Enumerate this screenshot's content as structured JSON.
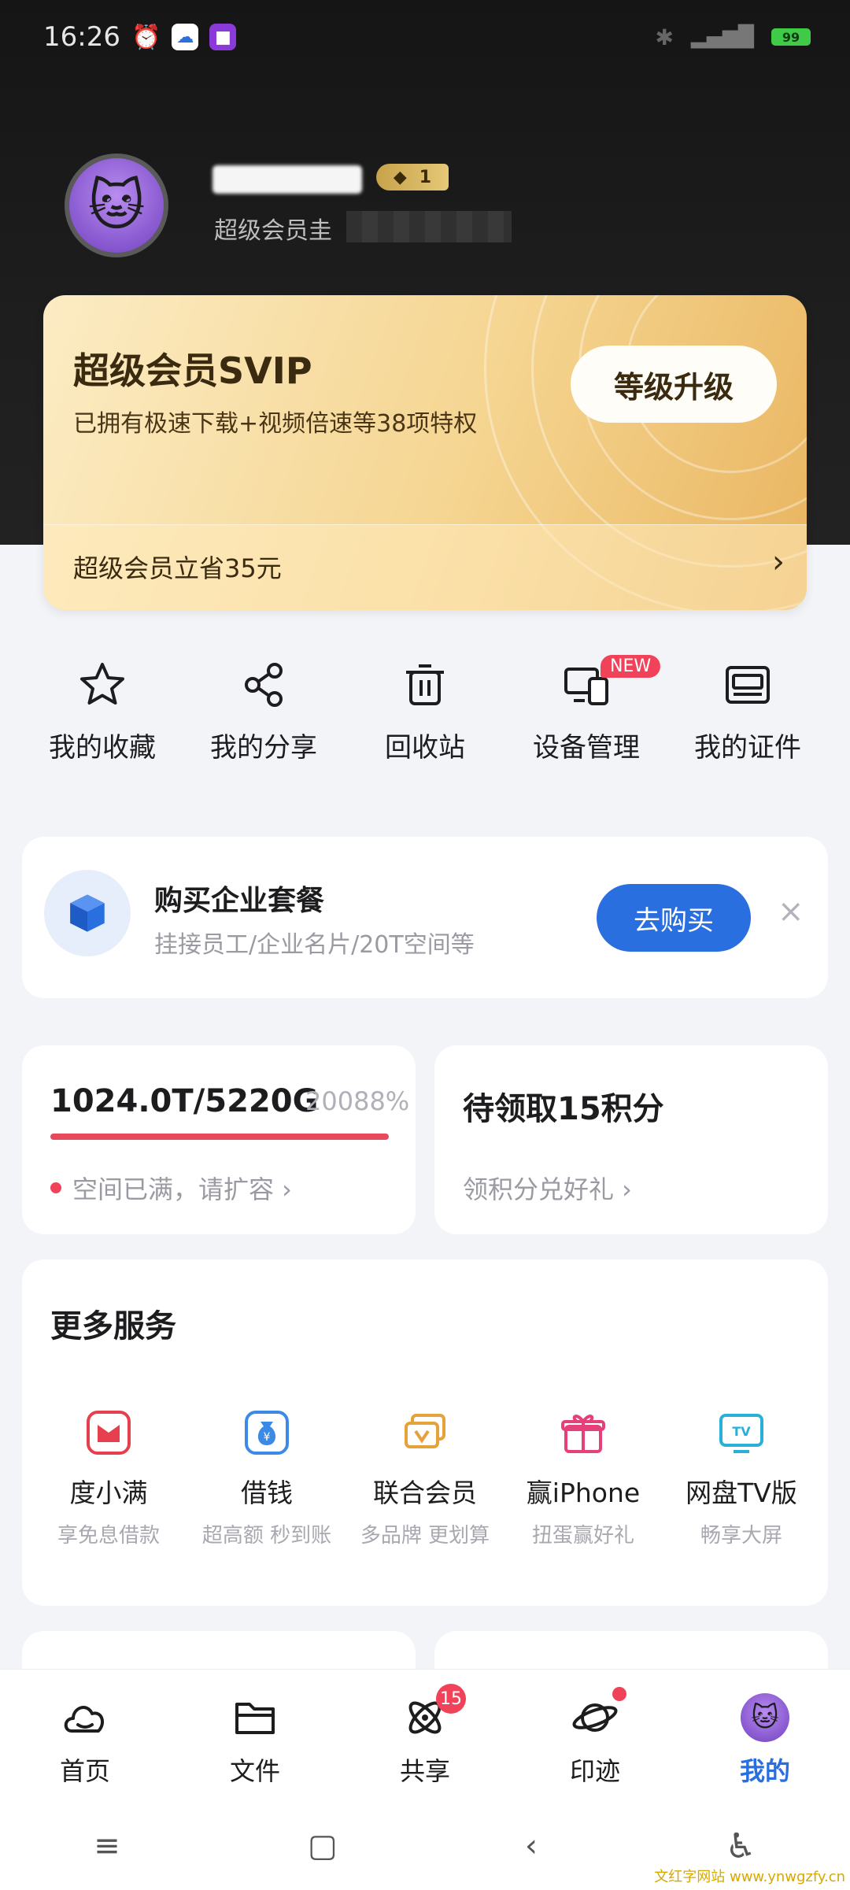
{
  "status_bar": {
    "time": "16:26",
    "battery": "99"
  },
  "profile": {
    "level_badge_num": "1",
    "subtitle": "超级会员圭"
  },
  "svip_card": {
    "title": "超级会员SVIP",
    "description": "已拥有极速下载+视频倍速等38项特权",
    "upgrade_button": "等级升级",
    "footer_text": "超级会员立省35元",
    "footer_arrow": "›"
  },
  "shortcuts": [
    {
      "label": "我的收藏",
      "icon": "star-icon"
    },
    {
      "label": "我的分享",
      "icon": "share-icon"
    },
    {
      "label": "回收站",
      "icon": "trash-icon"
    },
    {
      "label": "设备管理",
      "icon": "devices-icon",
      "badge": "NEW"
    },
    {
      "label": "我的证件",
      "icon": "id-card-icon"
    }
  ],
  "enterprise": {
    "title": "购买企业套餐",
    "subtitle": "挂接员工/企业名片/20T空间等",
    "buy_button": "去购买",
    "close": "×"
  },
  "storage": {
    "value": "1024.0T/5220G",
    "percent": "20088%",
    "fill_fraction": 1.0,
    "status": "空间已满，请扩容 ›"
  },
  "points": {
    "title": "待领取15积分",
    "subtitle": "领积分兑好礼 ›"
  },
  "services": {
    "title": "更多服务",
    "items": [
      {
        "name": "度小满",
        "desc": "享免息借款",
        "icon": "duxiaoman-icon",
        "color": "#e6404f"
      },
      {
        "name": "借钱",
        "desc": "超高额 秒到账",
        "icon": "money-bag-icon",
        "color": "#3a8ae6"
      },
      {
        "name": "联合会员",
        "desc": "多品牌 更划算",
        "icon": "vip-cards-icon",
        "color": "#e6a23a"
      },
      {
        "name": "赢iPhone",
        "desc": "扭蛋赢好礼",
        "icon": "gift-icon",
        "color": "#e6407a"
      },
      {
        "name": "网盘TV版",
        "desc": "畅享大屏",
        "icon": "tv-icon",
        "color": "#2ab0d8"
      }
    ]
  },
  "bottom_nav": [
    {
      "label": "首页",
      "icon": "cloud-home-icon"
    },
    {
      "label": "文件",
      "icon": "folder-icon"
    },
    {
      "label": "共享",
      "icon": "atom-share-icon",
      "badge": "15"
    },
    {
      "label": "印迹",
      "icon": "planet-icon",
      "dot": true
    },
    {
      "label": "我的",
      "icon": "avatar-icon",
      "active": true
    }
  ],
  "system_nav": {
    "menu": "≡",
    "home": "▢",
    "back": "‹"
  },
  "watermark": "文红字网站 www.ynwgzfy.cn",
  "colors": {
    "accent": "#2a6fe0",
    "alert": "#f0435a",
    "gold": "#f5d591"
  }
}
